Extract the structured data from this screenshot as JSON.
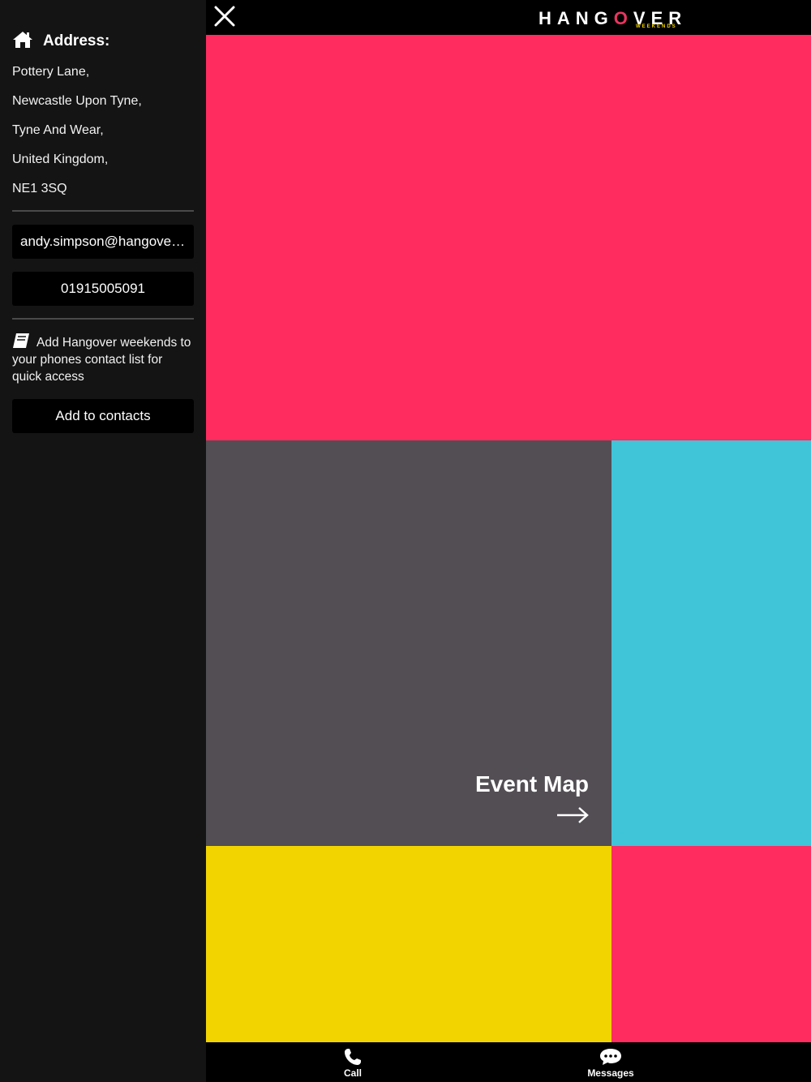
{
  "sidebar": {
    "address_title": "Address:",
    "address_lines": [
      "Pottery Lane,",
      "Newcastle Upon Tyne,",
      "Tyne And Wear,",
      "United Kingdom,",
      "NE1 3SQ"
    ],
    "email": "andy.simpson@hangover...",
    "phone": "01915005091",
    "contact_text": "Add Hangover weekends to your phones contact list for quick access",
    "add_contacts_label": "Add to contacts"
  },
  "header": {
    "logo_pre": "HANG",
    "logo_o": "O",
    "logo_post": "VER",
    "logo_sub": "WEEKENDS"
  },
  "tiles": {
    "event_map_label": "Event Map"
  },
  "bottom_nav": {
    "call_label": "Call",
    "messages_label": "Messages"
  },
  "colors": {
    "red": "#fe2c5f",
    "grey": "#524e54",
    "cyan": "#40c4d8",
    "yellow": "#f2d500"
  }
}
